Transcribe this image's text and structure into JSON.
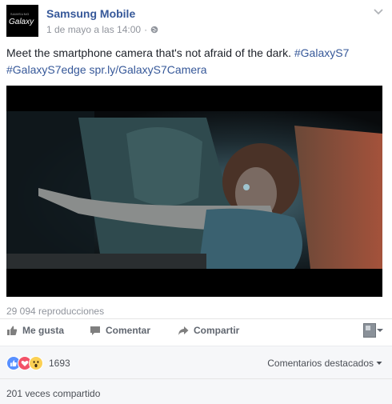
{
  "page": {
    "avatar_small": "SAMSUNG",
    "avatar_brand": "Galaxy",
    "name": "Samsung Mobile",
    "timestamp": "1 de mayo a las 14:00",
    "separator": "·"
  },
  "post": {
    "text": "Meet the smartphone camera that's not afraid of the dark. ",
    "hashtag1": "#GalaxyS7",
    "hashtag2": "#GalaxyS7edge",
    "link": "spr.ly/GalaxyS7Camera"
  },
  "video": {
    "views": "29 094 reproducciones"
  },
  "actions": {
    "like": "Me gusta",
    "comment": "Comentar",
    "share": "Compartir"
  },
  "reactions": {
    "count": "1693",
    "icons": [
      "like-icon",
      "love-icon",
      "wow-icon"
    ],
    "colors": {
      "like": "#5890ff",
      "love": "#f25268",
      "wow": "#fbd053"
    }
  },
  "comments": {
    "sort_label": "Comentarios destacados"
  },
  "shares": {
    "label": "201 veces compartido"
  },
  "colors": {
    "link": "#365899",
    "meta": "#90949c",
    "action": "#616770"
  }
}
